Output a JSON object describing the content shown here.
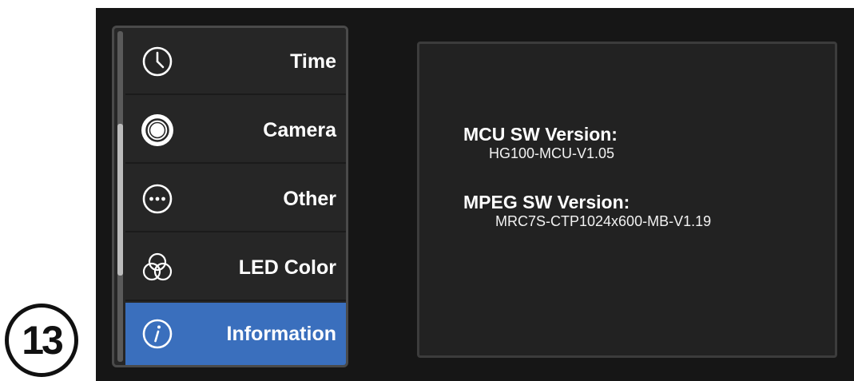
{
  "step_marker": "13",
  "menu": {
    "items": [
      {
        "label": "Time",
        "icon": "clock-icon"
      },
      {
        "label": "Camera",
        "icon": "camera-icon"
      },
      {
        "label": "Other",
        "icon": "more-icon"
      },
      {
        "label": "LED Color",
        "icon": "color-circles-icon"
      },
      {
        "label": "Information",
        "icon": "info-icon",
        "selected": true
      }
    ]
  },
  "info": {
    "mcu_label": "MCU SW Version:",
    "mcu_value": "HG100-MCU-V1.05",
    "mpeg_label": "MPEG SW Version:",
    "mpeg_value": "MRC7S-CTP1024x600-MB-V1.19"
  },
  "colors": {
    "selected_item": "#3a6fbd",
    "menu_bg": "#262626",
    "screen_bg": "#161616"
  }
}
